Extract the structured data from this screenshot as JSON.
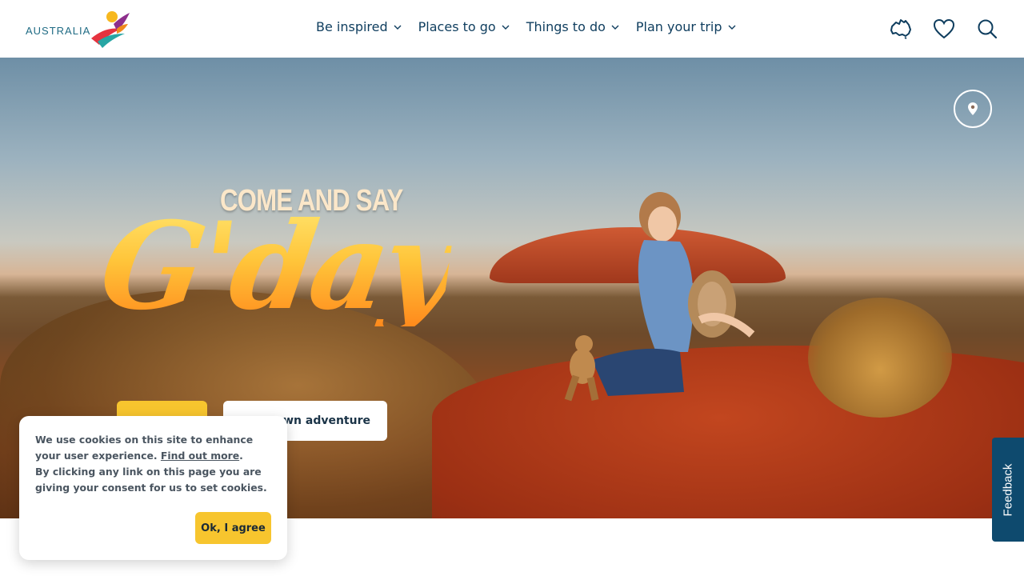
{
  "header": {
    "logo_text": "AUSTRALIA",
    "nav": [
      {
        "label": "Be inspired"
      },
      {
        "label": "Places to go"
      },
      {
        "label": "Things to do"
      },
      {
        "label": "Plan your trip"
      }
    ],
    "icons": [
      "australia-map-icon",
      "heart-icon",
      "search-icon"
    ]
  },
  "hero": {
    "headline_small": "COME AND SAY",
    "headline_big": "G'day",
    "primary_button_label": "",
    "secondary_button_label": "r own adventure"
  },
  "cookie": {
    "text_1": "We use cookies on this site to enhance your user experience.",
    "link": "Find out more",
    "period": ".",
    "text_2": "By clicking any link on this page you are giving your consent for us to set cookies.",
    "button": "Ok, I agree"
  },
  "feedback_label": "Feedback",
  "colors": {
    "navy": "#0e3d5e",
    "yellow": "#f7c52e",
    "feedback_bg": "#0e4a6e"
  }
}
